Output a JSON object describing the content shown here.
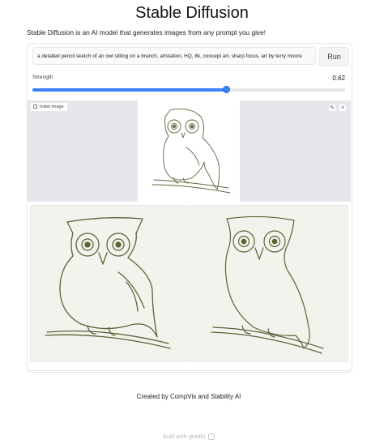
{
  "page": {
    "title": "Stable Diffusion",
    "description": "Stable Diffusion is an AI model that generates images from any prompt you give!"
  },
  "prompt": {
    "value": "a detailed pencil sketch of an owl sitting on a branch, artstation, HQ, 8k, concept art, sharp focus, art by terry moore"
  },
  "run_button": {
    "label": "Run"
  },
  "strength": {
    "label": "Strength",
    "value": 0.62,
    "value_label": "0.62"
  },
  "initial_image": {
    "label": "Initial Image"
  },
  "icons": {
    "initial_label": "image-icon",
    "edit": "pencil-icon",
    "close": "close-icon",
    "footer": "gradio-logo-icon"
  },
  "credit": "Created by CompVis and Stability AI",
  "footer": {
    "label": "built with gradio"
  },
  "colors": {
    "accent": "#3b82f6",
    "image_background": "#e5e7eb",
    "sketch_line": "#5b6437"
  }
}
